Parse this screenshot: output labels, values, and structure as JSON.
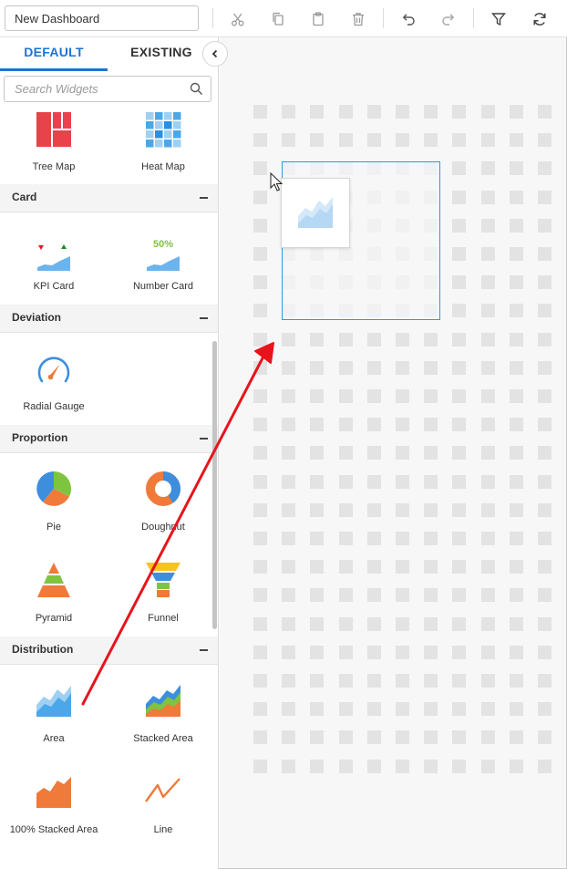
{
  "toolbar": {
    "dashboard_name": "New Dashboard",
    "buttons": [
      "cut-icon",
      "copy-icon",
      "paste-icon",
      "delete-icon",
      "undo-icon",
      "redo-icon",
      "filter-icon",
      "refresh-icon"
    ]
  },
  "panel": {
    "tabs": [
      {
        "label": "DEFAULT",
        "active": true
      },
      {
        "label": "EXISTING",
        "active": false
      }
    ],
    "search_placeholder": "Search Widgets",
    "widgets_top": [
      {
        "label": "Tree Map",
        "icon": "treemap-icon"
      },
      {
        "label": "Heat Map",
        "icon": "heatmap-icon"
      }
    ],
    "categories": [
      {
        "title": "Card",
        "widgets": [
          {
            "label": "KPI Card",
            "icon": "kpi-card-icon"
          },
          {
            "label": "Number Card",
            "icon": "number-card-icon",
            "value": "50%"
          }
        ]
      },
      {
        "title": "Deviation",
        "widgets": [
          {
            "label": "Radial Gauge",
            "icon": "radial-gauge-icon"
          }
        ]
      },
      {
        "title": "Proportion",
        "widgets": [
          {
            "label": "Pie",
            "icon": "pie-icon"
          },
          {
            "label": "Doughnut",
            "icon": "doughnut-icon"
          },
          {
            "label": "Pyramid",
            "icon": "pyramid-icon"
          },
          {
            "label": "Funnel",
            "icon": "funnel-icon"
          }
        ]
      },
      {
        "title": "Distribution",
        "widgets": [
          {
            "label": "Area",
            "icon": "area-icon"
          },
          {
            "label": "Stacked Area",
            "icon": "stacked-area-icon"
          },
          {
            "label": "100% Stacked Area",
            "icon": "stacked-area-100-icon"
          },
          {
            "label": "Line",
            "icon": "line-icon"
          }
        ]
      }
    ]
  },
  "colors": {
    "accent": "#1b74d6",
    "drop_zone_border": "#2d9bd6",
    "annotation_arrow": "#e8141c",
    "grid_cell": "#e3e3e3",
    "canvas_bg": "#f7f7f7"
  }
}
